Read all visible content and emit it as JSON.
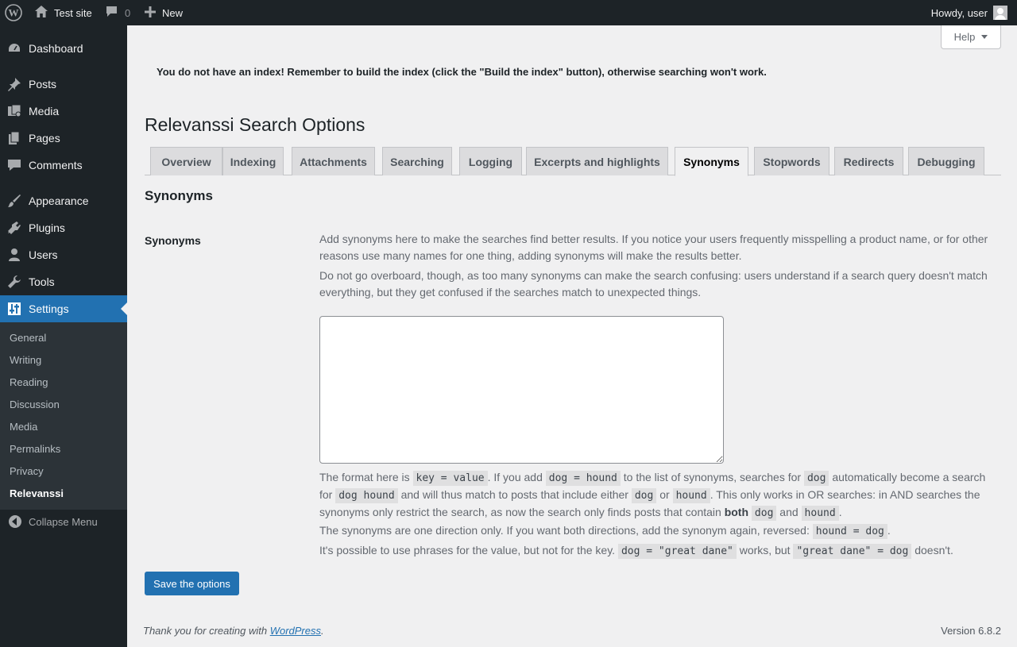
{
  "adminbar": {
    "site_name": "Test site",
    "comments_count": "0",
    "new_label": "New",
    "howdy": "Howdy, user"
  },
  "sidebar": {
    "items": [
      {
        "label": "Dashboard",
        "icon": "dashboard-icon"
      },
      {
        "label": "Posts",
        "icon": "pin-icon"
      },
      {
        "label": "Media",
        "icon": "media-icon"
      },
      {
        "label": "Pages",
        "icon": "pages-icon"
      },
      {
        "label": "Comments",
        "icon": "comment-icon"
      },
      {
        "label": "Appearance",
        "icon": "paintbrush-icon"
      },
      {
        "label": "Plugins",
        "icon": "plugin-icon"
      },
      {
        "label": "Users",
        "icon": "user-icon"
      },
      {
        "label": "Tools",
        "icon": "wrench-icon"
      },
      {
        "label": "Settings",
        "icon": "settings-icon"
      }
    ],
    "submenu": [
      "General",
      "Writing",
      "Reading",
      "Discussion",
      "Media",
      "Permalinks",
      "Privacy",
      "Relevanssi"
    ],
    "collapse": "Collapse Menu"
  },
  "help": "Help",
  "notice": "You do not have an index! Remember to build the index (click the \"Build the index\" button), otherwise searching won't work.",
  "page_title": "Relevanssi Search Options",
  "tabs": [
    "Overview",
    "Indexing",
    "Attachments",
    "Searching",
    "Logging",
    "Excerpts and highlights",
    "Synonyms",
    "Stopwords",
    "Redirects",
    "Debugging"
  ],
  "active_tab": "Synonyms",
  "section_title": "Synonyms",
  "field_label": "Synonyms",
  "desc1": "Add synonyms here to make the searches find better results. If you notice your users frequently misspelling a product name, or for other reasons use many names for one thing, adding synonyms will make the results better.",
  "desc2": "Do not go overboard, though, as too many synonyms can make the search confusing: users understand if a search query doesn't match everything, but they get confused if the searches match to unexpected things.",
  "textarea_value": "",
  "help_text": {
    "p1": {
      "t1": "The format here is ",
      "c1": "key = value",
      "t2": ". If you add ",
      "c2": "dog = hound",
      "t3": " to the list of synonyms, searches for ",
      "c3": "dog",
      "t4": " automatically become a search for ",
      "c4": "dog hound",
      "t5": " and will thus match to posts that include either ",
      "c5": "dog",
      "t6": " or ",
      "c6": "hound",
      "t7": ". This only works in OR searches: in AND searches the synonyms only restrict the search, as now the search only finds posts that contain ",
      "b1": "both",
      "t8": " ",
      "c7": "dog",
      "t9": " and ",
      "c8": "hound",
      "t10": "."
    },
    "p2": {
      "t1": "The synonyms are one direction only. If you want both directions, add the synonym again, reversed: ",
      "c1": "hound = dog",
      "t2": "."
    },
    "p3": {
      "t1": "It's possible to use phrases for the value, but not for the key. ",
      "c1": "dog = \"great dane\"",
      "t2": " works, but ",
      "c2": "\"great dane\" = dog",
      "t3": " doesn't."
    }
  },
  "save_button": "Save the options",
  "footer": {
    "thanks_prefix": "Thank you for creating with ",
    "wordpress_link": "WordPress",
    "thanks_suffix": ".",
    "version": "Version 6.8.2"
  },
  "colors": {
    "admin_dark": "#1d2327",
    "accent": "#2271b1",
    "background": "#f0f0f1"
  }
}
